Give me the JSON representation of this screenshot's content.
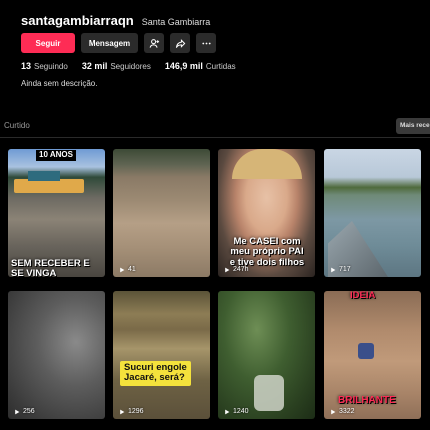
{
  "profile": {
    "username": "santagambiarraqn",
    "nickname": "Santa Gambiarra",
    "follow_label": "Seguir",
    "message_label": "Mensagem",
    "stats": [
      {
        "value": "13",
        "label": "Seguindo"
      },
      {
        "value": "32 mil",
        "label": "Seguidores"
      },
      {
        "value": "146,9 mil",
        "label": "Curtidas"
      }
    ],
    "bio": "Ainda sem descrição."
  },
  "tabs": {
    "liked_label": "Curtido",
    "sort_label": "Mais recentes"
  },
  "colors": {
    "accent": "#fe2c55",
    "button_dark": "#2b2b2b"
  },
  "videos": [
    {
      "views": "",
      "caption_top": "10 ANOS",
      "caption_bottom": "SEM RECEBER E\nSE VINGA"
    },
    {
      "views": "41"
    },
    {
      "views": "247h",
      "caption_bottom": "Me CASEI com\nmeu próprio PAI\ne tive dois filhos"
    },
    {
      "views": "717"
    },
    {
      "views": "256"
    },
    {
      "views": "1296",
      "caption_mid": "Sucuri engole\nJacaré, será?"
    },
    {
      "views": "1240"
    },
    {
      "views": "3322",
      "caption_top": "IDEIA",
      "caption_bottom": "BRILHANTE"
    }
  ]
}
